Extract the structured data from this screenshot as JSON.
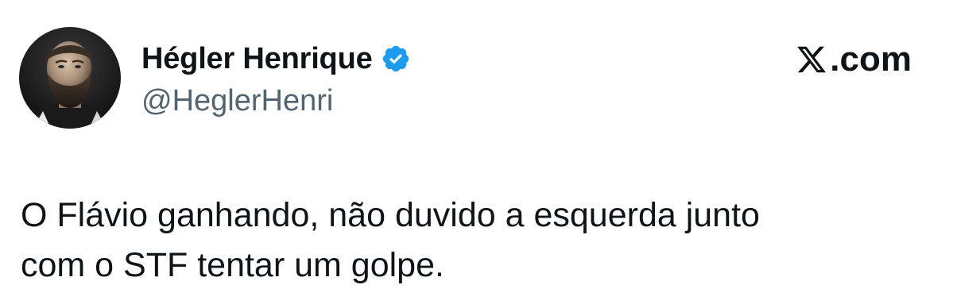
{
  "author": {
    "display_name": "Hégler Henrique",
    "handle": "@HeglerHenri",
    "verified": true,
    "avatar_icon": "profile-photo"
  },
  "brand": {
    "suffix": ".com",
    "icon": "x-logo-icon"
  },
  "tweet": {
    "text": "O Flávio ganhando, não duvido a esquerda junto\ncom o STF tentar um golpe."
  },
  "colors": {
    "text": "#0f1419",
    "secondary_text": "#536471",
    "verified_badge": "#1d9bf0",
    "background": "#ffffff"
  }
}
